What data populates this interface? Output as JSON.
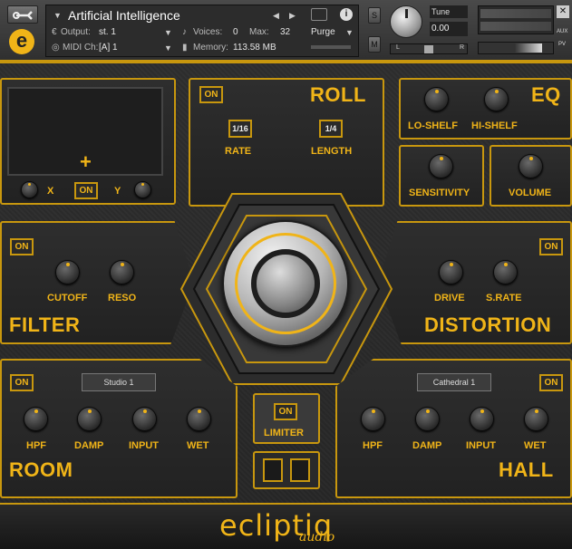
{
  "header": {
    "instrument_name": "Artificial Intelligence",
    "output_label": "Output:",
    "output_value": "st. 1",
    "midi_label": "MIDI Ch:",
    "midi_value": "[A]  1",
    "voices_label": "Voices:",
    "voices_value": "0",
    "max_label": "Max:",
    "max_value": "32",
    "memory_label": "Memory:",
    "memory_value": "113.58 MB",
    "purge_label": "Purge",
    "solo_label": "S",
    "mute_label": "M",
    "tune_label": "Tune",
    "tune_value": "0.00",
    "pan_left": "L",
    "pan_right": "R",
    "aux_label": "AUX",
    "pv_label": "PV"
  },
  "xy": {
    "x_label": "X",
    "y_label": "Y",
    "on_label": "ON"
  },
  "roll": {
    "title": "ROLL",
    "on_label": "ON",
    "rate_value": "1/16",
    "length_value": "1/4",
    "rate_label": "RATE",
    "length_label": "LENGTH"
  },
  "eq": {
    "title": "EQ",
    "lo_shelf": "LO-SHELF",
    "hi_shelf": "HI-SHELF"
  },
  "sensitivity": {
    "label": "SENSITIVITY"
  },
  "volume": {
    "label": "VOLUME"
  },
  "filter": {
    "title": "FILTER",
    "on_label": "ON",
    "cutoff": "CUTOFF",
    "reso": "RESO"
  },
  "distortion": {
    "title": "DISTORTION",
    "on_label": "ON",
    "drive": "DRIVE",
    "srate": "S.RATE"
  },
  "room": {
    "title": "ROOM",
    "on_label": "ON",
    "preset": "Studio 1",
    "hpf": "HPF",
    "damp": "DAMP",
    "input": "INPUT",
    "wet": "WET"
  },
  "hall": {
    "title": "HALL",
    "on_label": "ON",
    "preset": "Cathedral 1",
    "hpf": "HPF",
    "damp": "DAMP",
    "input": "INPUT",
    "wet": "WET"
  },
  "limiter": {
    "on_label": "ON",
    "label": "LIMITER"
  },
  "footer": {
    "brand": "ecliptiq",
    "sub": "audio"
  },
  "colors": {
    "accent": "#f0b418",
    "border": "#c8970e",
    "background": "#262626"
  }
}
